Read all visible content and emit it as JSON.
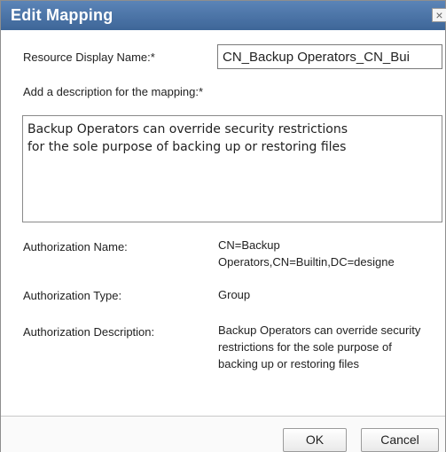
{
  "dialog": {
    "title": "Edit Mapping",
    "close_glyph": "×"
  },
  "form": {
    "resource_display_name_label": "Resource Display Name:*",
    "resource_display_name_value": "CN_Backup Operators_CN_Bui",
    "description_label": "Add a description for the mapping:*",
    "description_value": "Backup Operators can override security restrictions\nfor the sole purpose of backing up or restoring files"
  },
  "details": {
    "authorization_name_label": "Authorization Name:",
    "authorization_name_line1": "CN=Backup",
    "authorization_name_line2": "Operators,CN=Builtin,DC=designe",
    "authorization_type_label": "Authorization Type:",
    "authorization_type_value": "Group",
    "authorization_description_label": "Authorization Description:",
    "authorization_description_value": "Backup Operators can override security restrictions for the sole purpose of backing up or restoring files"
  },
  "buttons": {
    "ok_label": "OK",
    "cancel_label": "Cancel"
  },
  "colors": {
    "titlebar": "#4a74a8",
    "title_text": "#ffffff"
  },
  "icons": {
    "close": "close-icon"
  }
}
